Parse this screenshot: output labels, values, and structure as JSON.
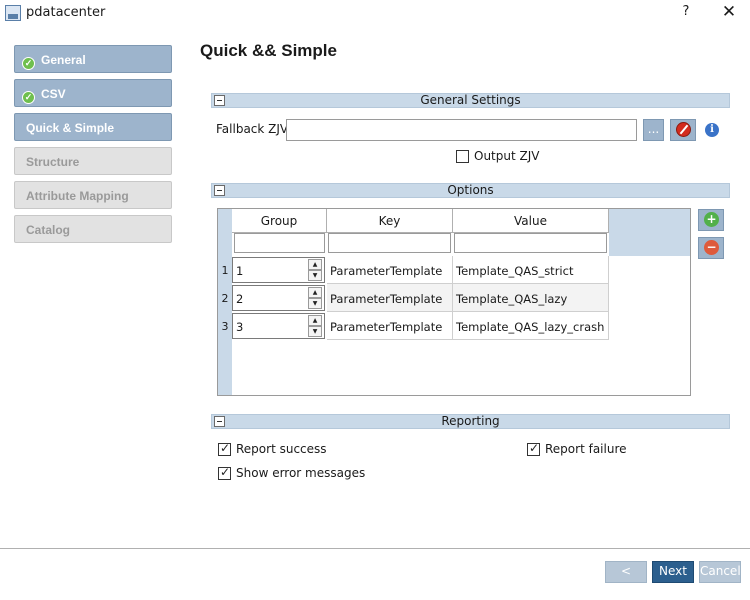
{
  "window": {
    "title": "pdatacenter",
    "help": "?",
    "close": "✕"
  },
  "sidebar": {
    "steps": [
      {
        "label": "General",
        "state": "done"
      },
      {
        "label": "CSV",
        "state": "done"
      },
      {
        "label": "Quick & Simple",
        "state": "active"
      },
      {
        "label": "Structure",
        "state": "disabled"
      },
      {
        "label": "Attribute Mapping",
        "state": "disabled"
      },
      {
        "label": "Catalog",
        "state": "disabled"
      }
    ]
  },
  "page": {
    "title": "Quick && Simple"
  },
  "general_settings": {
    "title": "General Settings",
    "fallback_label": "Fallback ZJV:",
    "fallback_value": "",
    "browse_label": "...",
    "output_zjv_label": "Output ZJV",
    "output_zjv_checked": false
  },
  "options": {
    "title": "Options",
    "columns": [
      "Group",
      "Key",
      "Value"
    ],
    "rows": [
      {
        "num": "1",
        "group": "1",
        "key": "ParameterTemplate",
        "value": "Template_QAS_strict"
      },
      {
        "num": "2",
        "group": "2",
        "key": "ParameterTemplate",
        "value": "Template_QAS_lazy"
      },
      {
        "num": "3",
        "group": "3",
        "key": "ParameterTemplate",
        "value": "Template_QAS_lazy_crash"
      }
    ]
  },
  "reporting": {
    "title": "Reporting",
    "report_success": "Report success",
    "report_failure": "Report failure",
    "show_errors": "Show error messages"
  },
  "footer": {
    "back": "< Back",
    "next": "Next >",
    "cancel": "Cancel"
  },
  "colors": {
    "accent": "#9db4cc",
    "section": "#c9d9e8",
    "primary": "#2c5f8e"
  }
}
